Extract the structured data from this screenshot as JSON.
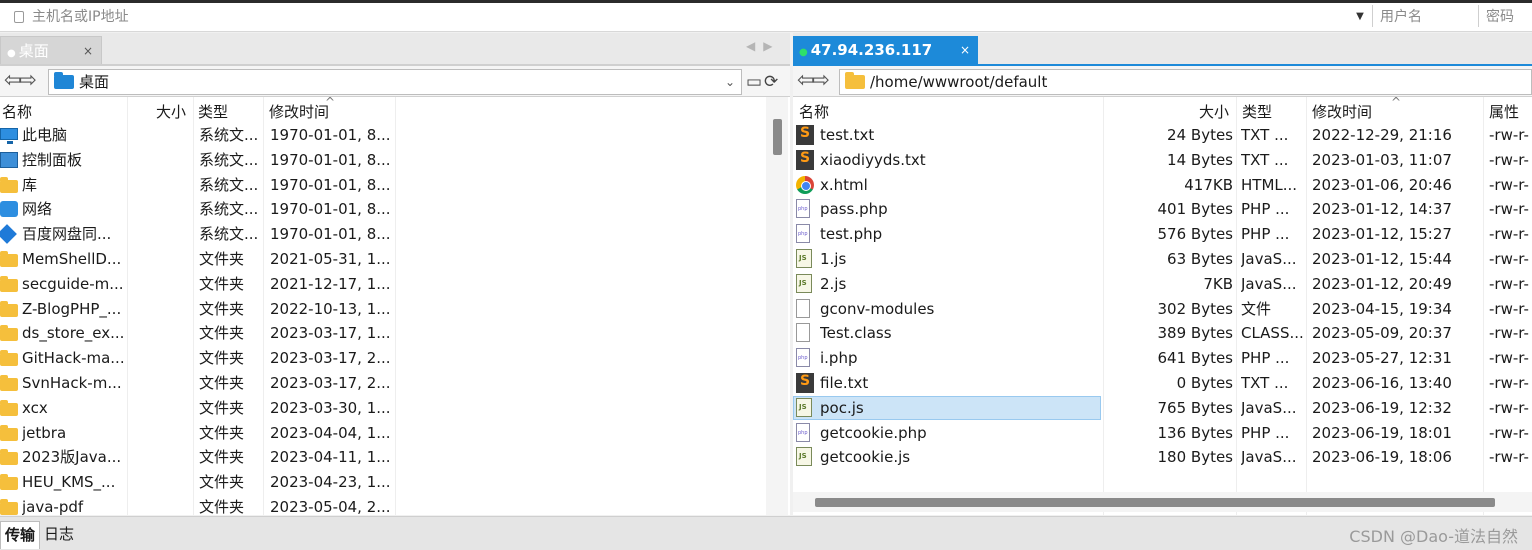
{
  "topbar": {
    "host_placeholder": "主机名或IP地址",
    "user_placeholder": "用户名",
    "password_placeholder": "密码"
  },
  "left": {
    "tab_label": "桌面",
    "path": "桌面",
    "headers": {
      "name": "名称",
      "size": "大小",
      "type": "类型",
      "modified": "修改时间"
    },
    "rows": [
      {
        "icon": "computer-icon",
        "name": "此电脑",
        "size": "",
        "type": "系统文...",
        "modified": "1970-01-01, 8..."
      },
      {
        "icon": "control-panel-icon",
        "name": "控制面板",
        "size": "",
        "type": "系统文...",
        "modified": "1970-01-01, 8..."
      },
      {
        "icon": "folder-icon",
        "name": "库",
        "size": "",
        "type": "系统文...",
        "modified": "1970-01-01, 8..."
      },
      {
        "icon": "network-icon",
        "name": "网络",
        "size": "",
        "type": "系统文...",
        "modified": "1970-01-01, 8..."
      },
      {
        "icon": "baidu-netdisk-icon",
        "name": "百度网盘同...",
        "size": "",
        "type": "系统文...",
        "modified": "1970-01-01, 8..."
      },
      {
        "icon": "folder-icon",
        "name": "MemShellD...",
        "size": "",
        "type": "文件夹",
        "modified": "2021-05-31, 1..."
      },
      {
        "icon": "folder-icon",
        "name": "secguide-m...",
        "size": "",
        "type": "文件夹",
        "modified": "2021-12-17, 1..."
      },
      {
        "icon": "folder-icon",
        "name": "Z-BlogPHP_...",
        "size": "",
        "type": "文件夹",
        "modified": "2022-10-13, 1..."
      },
      {
        "icon": "folder-icon",
        "name": "ds_store_ex...",
        "size": "",
        "type": "文件夹",
        "modified": "2023-03-17, 1..."
      },
      {
        "icon": "folder-icon",
        "name": "GitHack-ma...",
        "size": "",
        "type": "文件夹",
        "modified": "2023-03-17, 2..."
      },
      {
        "icon": "folder-icon",
        "name": "SvnHack-m...",
        "size": "",
        "type": "文件夹",
        "modified": "2023-03-17, 2..."
      },
      {
        "icon": "folder-icon",
        "name": "xcx",
        "size": "",
        "type": "文件夹",
        "modified": "2023-03-30, 1..."
      },
      {
        "icon": "folder-icon",
        "name": "jetbra",
        "size": "",
        "type": "文件夹",
        "modified": "2023-04-04, 1..."
      },
      {
        "icon": "folder-icon",
        "name": "2023版Java...",
        "size": "",
        "type": "文件夹",
        "modified": "2023-04-11, 1..."
      },
      {
        "icon": "folder-icon",
        "name": "HEU_KMS_...",
        "size": "",
        "type": "文件夹",
        "modified": "2023-04-23, 1..."
      },
      {
        "icon": "folder-icon",
        "name": "java-pdf",
        "size": "",
        "type": "文件夹",
        "modified": "2023-05-04, 2..."
      }
    ]
  },
  "right": {
    "tab_label": "47.94.236.117",
    "path": "/home/wwwroot/default",
    "headers": {
      "name": "名称",
      "size": "大小",
      "type": "类型",
      "modified": "修改时间",
      "attr": "属性"
    },
    "rows": [
      {
        "icon": "sublime-text-icon",
        "name": "test.txt",
        "size": "24 Bytes",
        "type": "TXT ...",
        "modified": "2022-12-29, 21:16",
        "attr": "-rw-r-"
      },
      {
        "icon": "sublime-text-icon",
        "name": "xiaodiyyds.txt",
        "size": "14 Bytes",
        "type": "TXT ...",
        "modified": "2023-01-03, 11:07",
        "attr": "-rw-r-"
      },
      {
        "icon": "chrome-icon",
        "name": "x.html",
        "size": "417KB",
        "type": "HTML...",
        "modified": "2023-01-06, 20:46",
        "attr": "-rw-r-"
      },
      {
        "icon": "php-file-icon",
        "name": "pass.php",
        "size": "401 Bytes",
        "type": "PHP ...",
        "modified": "2023-01-12, 14:37",
        "attr": "-rw-r-"
      },
      {
        "icon": "php-file-icon",
        "name": "test.php",
        "size": "576 Bytes",
        "type": "PHP ...",
        "modified": "2023-01-12, 15:27",
        "attr": "-rw-r-"
      },
      {
        "icon": "js-file-icon",
        "name": "1.js",
        "size": "63 Bytes",
        "type": "JavaS...",
        "modified": "2023-01-12, 15:44",
        "attr": "-rw-r-"
      },
      {
        "icon": "js-file-icon",
        "name": "2.js",
        "size": "7KB",
        "type": "JavaS...",
        "modified": "2023-01-12, 20:49",
        "attr": "-rw-r-"
      },
      {
        "icon": "blank-file-icon",
        "name": "gconv-modules",
        "size": "302 Bytes",
        "type": "文件",
        "modified": "2023-04-15, 19:34",
        "attr": "-rw-r-"
      },
      {
        "icon": "blank-file-icon",
        "name": "Test.class",
        "size": "389 Bytes",
        "type": "CLASS...",
        "modified": "2023-05-09, 20:37",
        "attr": "-rw-r-"
      },
      {
        "icon": "php-file-icon",
        "name": "i.php",
        "size": "641 Bytes",
        "type": "PHP ...",
        "modified": "2023-05-27, 12:31",
        "attr": "-rw-r-"
      },
      {
        "icon": "sublime-text-icon",
        "name": "file.txt",
        "size": "0 Bytes",
        "type": "TXT ...",
        "modified": "2023-06-16, 13:40",
        "attr": "-rw-r-"
      },
      {
        "icon": "js-file-icon",
        "name": "poc.js",
        "size": "765 Bytes",
        "type": "JavaS...",
        "modified": "2023-06-19, 12:32",
        "attr": "-rw-r-",
        "selected": true
      },
      {
        "icon": "php-file-icon",
        "name": "getcookie.php",
        "size": "136 Bytes",
        "type": "PHP ...",
        "modified": "2023-06-19, 18:01",
        "attr": "-rw-r-"
      },
      {
        "icon": "js-file-icon",
        "name": "getcookie.js",
        "size": "180 Bytes",
        "type": "JavaS...",
        "modified": "2023-06-19, 18:06",
        "attr": "-rw-r-"
      }
    ]
  },
  "bottom": {
    "transfer_tab": "传输",
    "log_tab": "日志",
    "watermark": "CSDN @Dao-道法自然"
  }
}
